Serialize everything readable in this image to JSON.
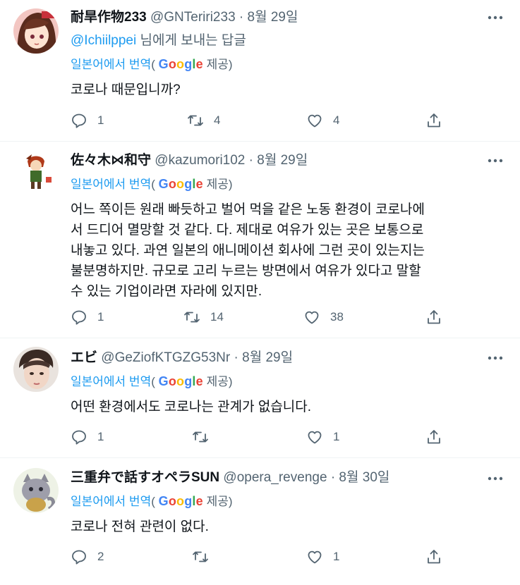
{
  "google_colors": {
    "blue": "#4285F4",
    "red": "#EA4335",
    "yellow": "#FBBC05",
    "green": "#34A853"
  },
  "tweets": [
    {
      "name": "耐旱作物233",
      "handle": "@GNTeriri233",
      "dot": "·",
      "date": "8월 29일",
      "reply_to": {
        "mention": "@Ichiilppei",
        "suffix": " 님에게 보내는 답글"
      },
      "translate": {
        "prefix": "일본어에서 번역",
        "open": "(",
        "google": "Google",
        "close": " 제공)"
      },
      "body": "코로나 때문입니까?",
      "actions": {
        "reply": "1",
        "retweet": "4",
        "like": "4"
      }
    },
    {
      "name": "佐々木⋈和守",
      "handle": "@kazumori102",
      "dot": "·",
      "date": "8월 29일",
      "translate": {
        "prefix": "일본어에서 번역",
        "open": "(",
        "google": "Google",
        "close": " 제공)"
      },
      "body_lines": [
        "어느 쪽이든 원래 빠듯하고 벌어 먹을 같은 노동 환경이 코로나에",
        "서 드디어 멸망할 것 같다. 다. 제대로 여유가 있는 곳은 보통으로",
        "내놓고 있다. 과연 일본의 애니메이션 회사에 그런 곳이 있는지는",
        "불분명하지만. 규모로 고리 누르는 방면에서 여유가 있다고 말할",
        "수 있는 기업이라면 자라에 있지만."
      ],
      "actions": {
        "reply": "1",
        "retweet": "14",
        "like": "38"
      }
    },
    {
      "name": "エビ",
      "handle": "@GeZiofKTGZG53Nr",
      "dot": "·",
      "date": "8월 29일",
      "translate": {
        "prefix": "일본어에서 번역",
        "open": "(",
        "google": "Google",
        "close": " 제공)"
      },
      "body": "어떤 환경에서도 코로나는 관계가 없습니다.",
      "actions": {
        "reply": "1",
        "retweet": "",
        "like": "1"
      }
    },
    {
      "name": "三重弁で話すオペラSUN",
      "handle": "@opera_revenge",
      "dot": "·",
      "date": "8월 30일",
      "translate": {
        "prefix": "일본어에서 번역",
        "open": "(",
        "google": "Google",
        "close": " 제공)"
      },
      "body": "코로나 전혀 관련이 없다.",
      "actions": {
        "reply": "2",
        "retweet": "",
        "like": "1"
      }
    }
  ]
}
